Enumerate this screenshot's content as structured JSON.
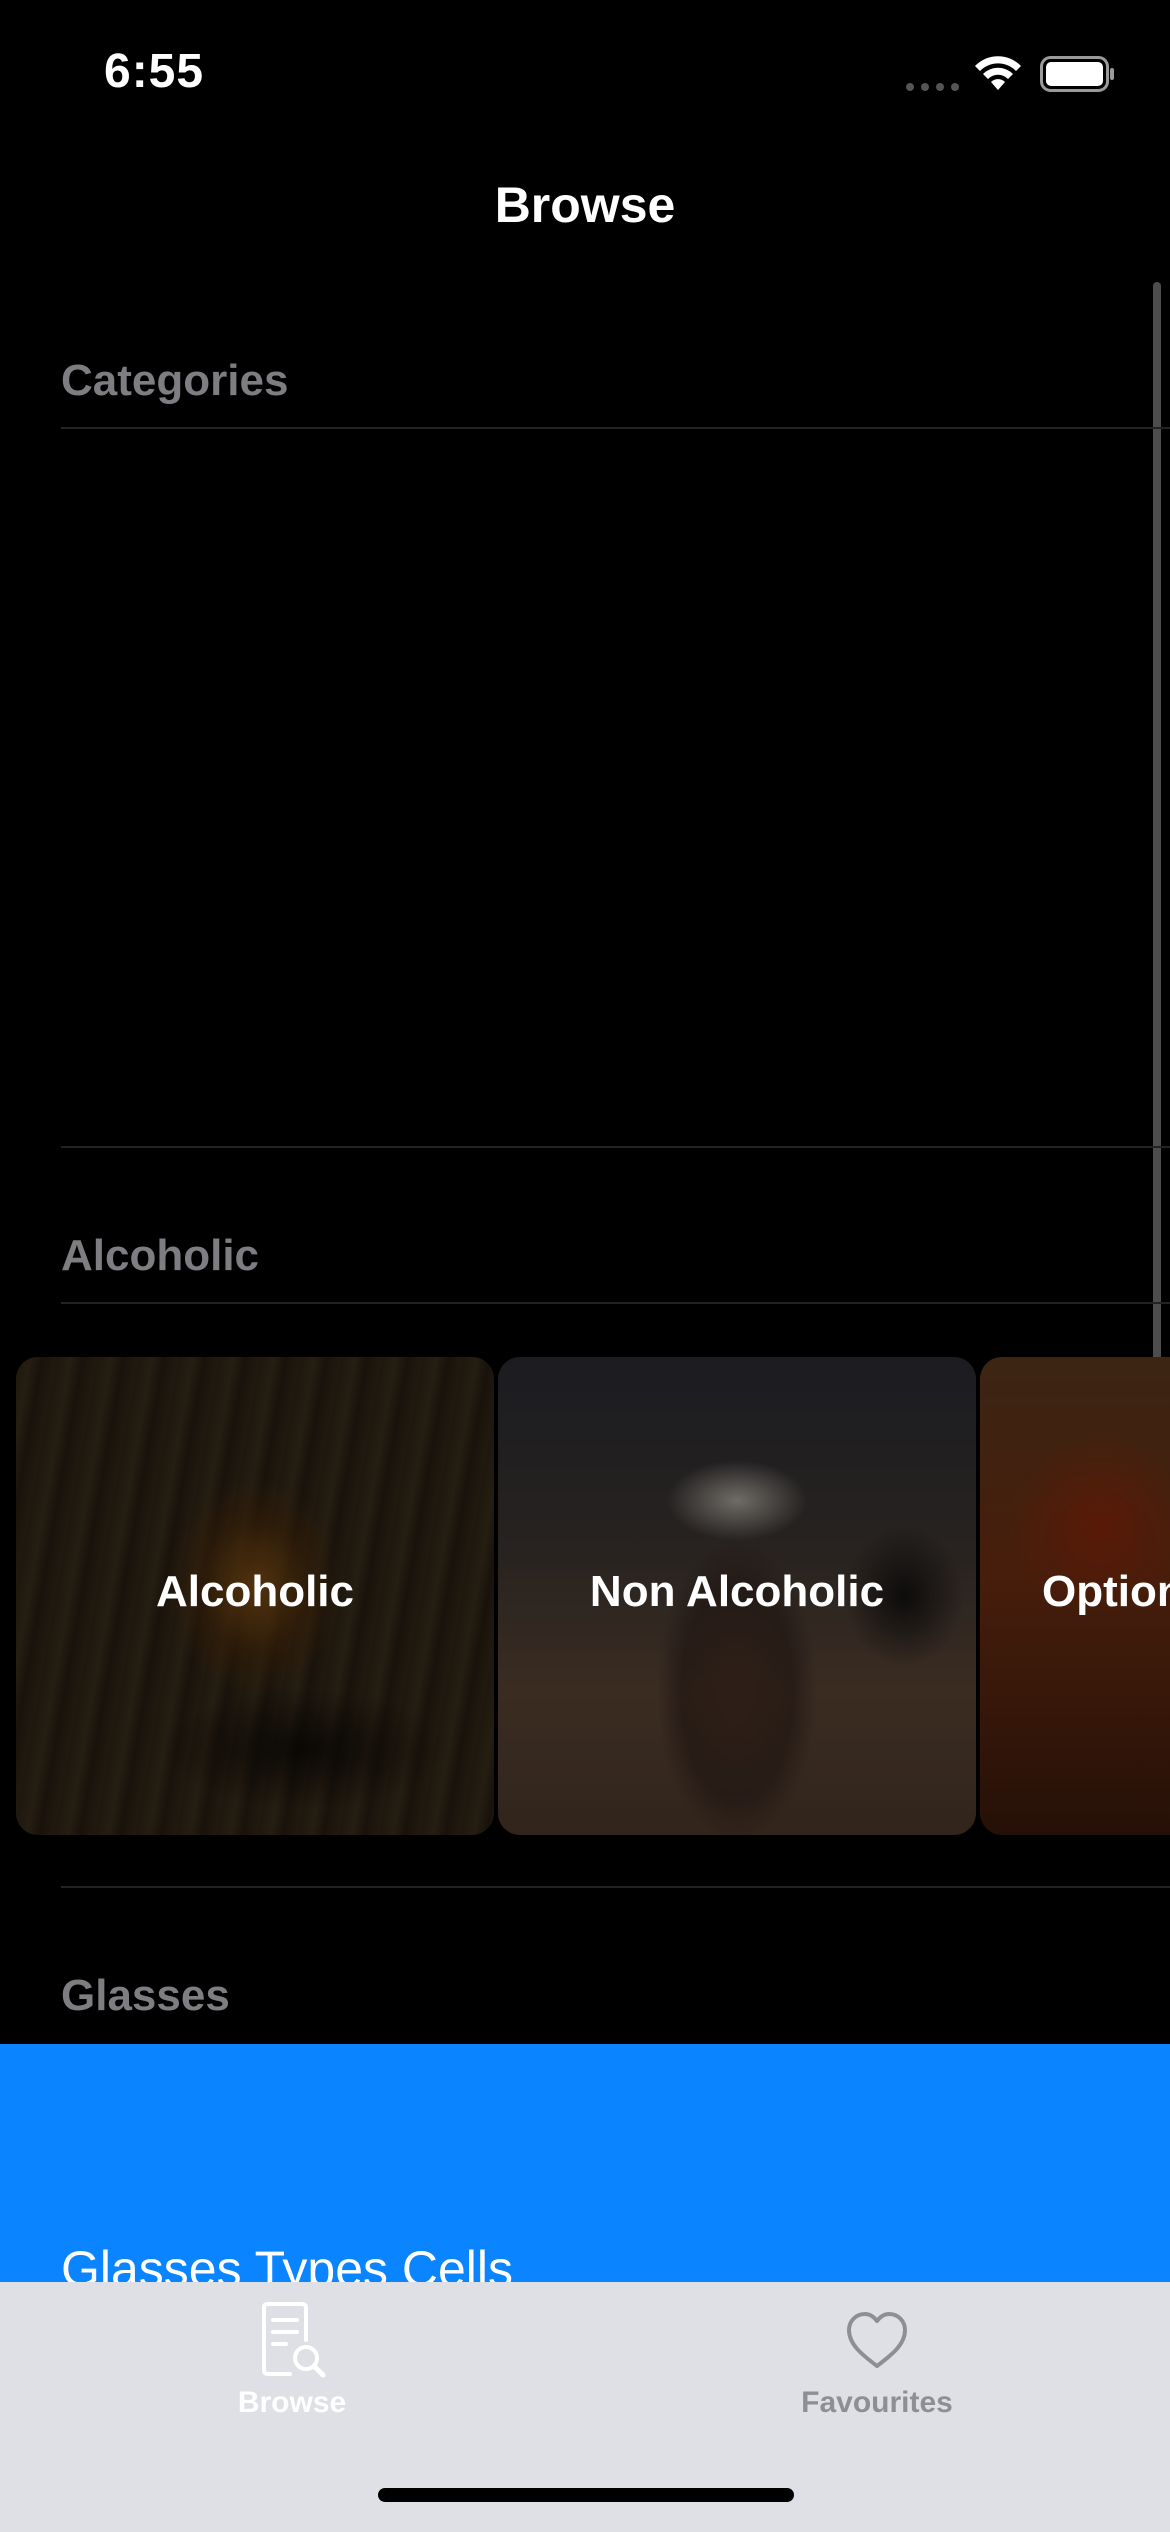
{
  "status_bar": {
    "time": "6:55"
  },
  "nav": {
    "title": "Browse"
  },
  "sections": {
    "categories": {
      "header": "Categories"
    },
    "alcoholic": {
      "header": "Alcoholic"
    },
    "glasses": {
      "header": "Glasses"
    }
  },
  "category_cards": [
    {
      "label": "Alcoholic"
    },
    {
      "label": "Non Alcoholic"
    },
    {
      "label": "Optional"
    }
  ],
  "glasses_block": {
    "label": "Glasses Types Cells",
    "color": "#0a84ff"
  },
  "tab_bar": {
    "items": [
      {
        "label": "Browse",
        "icon": "document-search-icon",
        "selected": true
      },
      {
        "label": "Favourites",
        "icon": "heart-icon",
        "selected": false
      }
    ]
  },
  "colors": {
    "background": "#000000",
    "section_header": "#7d7d82",
    "tab_bar_background": "#dfe0e6",
    "tab_inactive": "#8e8e93"
  }
}
